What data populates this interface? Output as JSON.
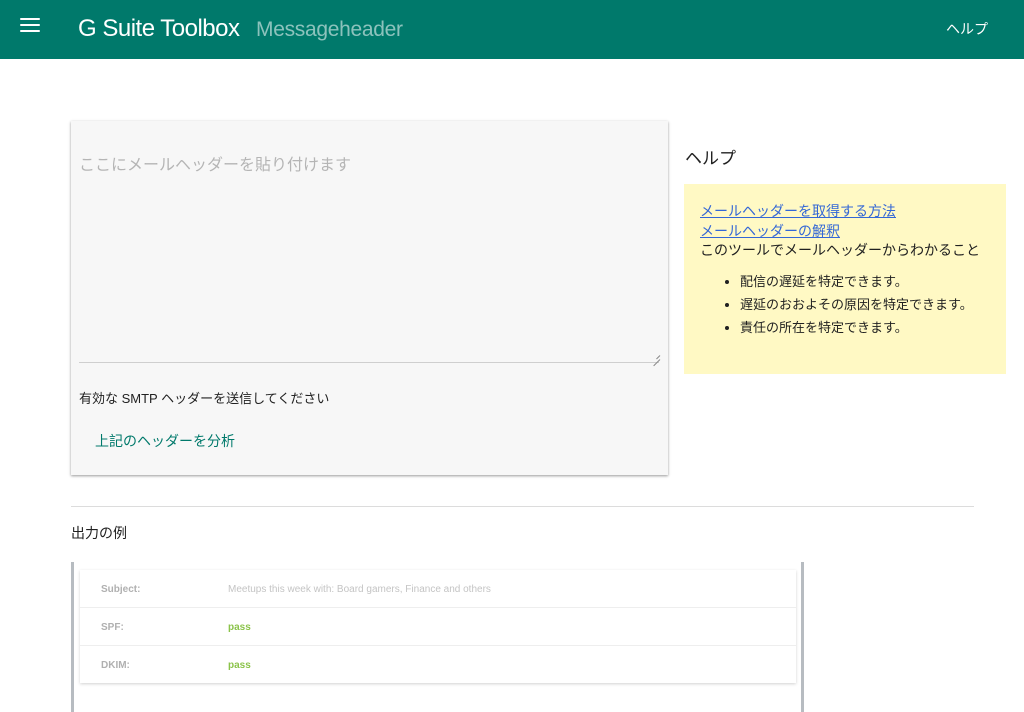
{
  "header": {
    "brand": "G Suite Toolbox",
    "product": "Messageheader",
    "help_label": "ヘルプ"
  },
  "form": {
    "placeholder": "ここにメールヘッダーを貼り付けます",
    "hint": "有効な SMTP ヘッダーを送信してください",
    "analyze_label": "上記のヘッダーを分析"
  },
  "help": {
    "title": "ヘルプ",
    "links": [
      "メールヘッダーを取得する方法",
      "メールヘッダーの解釈"
    ],
    "intro": "このツールでメールヘッダーからわかること",
    "items": [
      "配信の遅延を特定できます。",
      "遅延のおおよその原因を特定できます。",
      "責任の所在を特定できます。"
    ]
  },
  "example": {
    "title": "出力の例",
    "rows": [
      {
        "key": "Subject:",
        "value": "Meetups this week with: Board gamers, Finance and others"
      },
      {
        "key": "SPF:",
        "value": "pass"
      },
      {
        "key": "DKIM:",
        "value": "pass"
      }
    ]
  },
  "icons": {
    "menu": "menu-icon",
    "resize": "resize-grip-icon"
  },
  "colors": {
    "primary": "#00796b",
    "help_bg": "#fff9c4",
    "link": "#3367d6",
    "pass": "#8bc34a"
  }
}
